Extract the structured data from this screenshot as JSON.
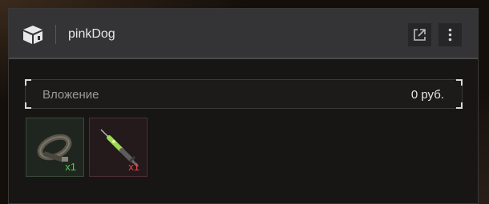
{
  "header": {
    "title": "pinkDog",
    "box_icon": "box-icon",
    "external_icon": "external-link-icon",
    "more_icon": "more-vertical-icon"
  },
  "investment": {
    "label": "Вложение",
    "value": "0 руб."
  },
  "items": [
    {
      "icon": "belt-icon",
      "quantity": "x1",
      "quantity_color": "#59c94f"
    },
    {
      "icon": "syringe-icon",
      "quantity": "x1",
      "quantity_color": "#dd4a4a"
    }
  ]
}
